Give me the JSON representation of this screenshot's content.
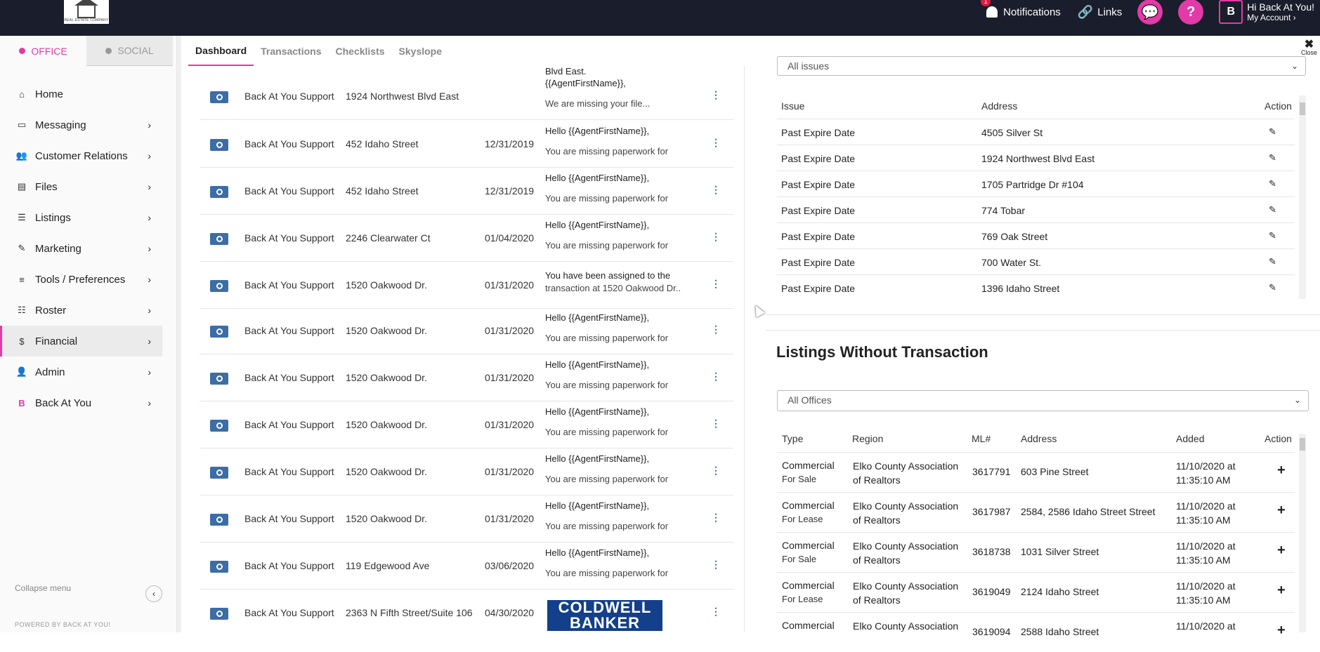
{
  "topbar": {
    "logo_text": "REAL ESTATE COMPANY",
    "notifications_label": "Notifications",
    "notifications_count": "1",
    "links_label": "Links",
    "chat_icon": "chat-bubble-icon",
    "help_icon": "?",
    "avatar_letter": "B",
    "greeting": "Hi Back At You!",
    "my_account": "My Account"
  },
  "sidebar": {
    "mode_tabs": [
      "OFFICE",
      "SOCIAL"
    ],
    "items": [
      {
        "label": "Home",
        "icon": "⌂"
      },
      {
        "label": "Messaging",
        "icon": "▭"
      },
      {
        "label": "Customer Relations",
        "icon": "👥"
      },
      {
        "label": "Files",
        "icon": "▤"
      },
      {
        "label": "Listings",
        "icon": "☰"
      },
      {
        "label": "Marketing",
        "icon": "✎"
      },
      {
        "label": "Tools / Preferences",
        "icon": "≡"
      },
      {
        "label": "Roster",
        "icon": "☷"
      },
      {
        "label": "Financial",
        "icon": "$"
      },
      {
        "label": "Admin",
        "icon": "👤"
      },
      {
        "label": "Back At You",
        "icon": "B"
      }
    ],
    "collapse_label": "Collapse menu",
    "powered_by": "POWERED BY BACK AT YOU!"
  },
  "main_tabs": [
    "Dashboard",
    "Transactions",
    "Checklists",
    "Skyslope"
  ],
  "close_label": "Close",
  "messages": {
    "partial_top": "Blvd East.",
    "rows": [
      {
        "sender": "Back At You Support",
        "address": "1924 Northwest Blvd East",
        "date": "",
        "msg1": "{{AgentFirstName}},",
        "msg2": "We are missing your file..."
      },
      {
        "sender": "Back At You Support",
        "address": "452 Idaho Street",
        "date": "12/31/2019",
        "msg1": "Hello {{AgentFirstName}},",
        "msg2": "You are missing paperwork for"
      },
      {
        "sender": "Back At You Support",
        "address": "452 Idaho Street",
        "date": "12/31/2019",
        "msg1": "Hello {{AgentFirstName}},",
        "msg2": "You are missing paperwork for"
      },
      {
        "sender": "Back At You Support",
        "address": "2246 Clearwater Ct",
        "date": "01/04/2020",
        "msg1": "Hello {{AgentFirstName}},",
        "msg2": "You are missing paperwork for"
      },
      {
        "sender": "Back At You Support",
        "address": "1520 Oakwood Dr.",
        "date": "01/31/2020",
        "msg1": "You have been assigned to the",
        "msg2": "transaction at 1520 Oakwood Dr.."
      },
      {
        "sender": "Back At You Support",
        "address": "1520 Oakwood Dr.",
        "date": "01/31/2020",
        "msg1": "Hello {{AgentFirstName}},",
        "msg2": "You are missing paperwork for"
      },
      {
        "sender": "Back At You Support",
        "address": "1520 Oakwood Dr.",
        "date": "01/31/2020",
        "msg1": "Hello {{AgentFirstName}},",
        "msg2": "You are missing paperwork for"
      },
      {
        "sender": "Back At You Support",
        "address": "1520 Oakwood Dr.",
        "date": "01/31/2020",
        "msg1": "Hello {{AgentFirstName}},",
        "msg2": "You are missing paperwork for"
      },
      {
        "sender": "Back At You Support",
        "address": "1520 Oakwood Dr.",
        "date": "01/31/2020",
        "msg1": "Hello {{AgentFirstName}},",
        "msg2": "You are missing paperwork for"
      },
      {
        "sender": "Back At You Support",
        "address": "1520 Oakwood Dr.",
        "date": "01/31/2020",
        "msg1": "Hello {{AgentFirstName}},",
        "msg2": "You are missing paperwork for"
      },
      {
        "sender": "Back At You Support",
        "address": "119 Edgewood Ave",
        "date": "03/06/2020",
        "msg1": "Hello {{AgentFirstName}},",
        "msg2": "You are missing paperwork for"
      },
      {
        "sender": "Back At You Support",
        "address": "2363 N Fifth Street/Suite 106",
        "date": "04/30/2020",
        "msg1": "",
        "msg2": ""
      }
    ],
    "coldwell_text": "COLDWELL BANKER"
  },
  "issues": {
    "filter_value": "All issues",
    "headers": [
      "Issue",
      "Address",
      "Action"
    ],
    "rows": [
      {
        "issue": "Past Expire Date",
        "address": "4505 Silver St"
      },
      {
        "issue": "Past Expire Date",
        "address": "1924 Northwest Blvd East"
      },
      {
        "issue": "Past Expire Date",
        "address": "1705 Partridge Dr #104"
      },
      {
        "issue": "Past Expire Date",
        "address": "774 Tobar"
      },
      {
        "issue": "Past Expire Date",
        "address": "769 Oak Street"
      },
      {
        "issue": "Past Expire Date",
        "address": "700 Water St."
      },
      {
        "issue": "Past Expire Date",
        "address": "1396 Idaho Street"
      }
    ],
    "edit_icon": "✎"
  },
  "listings": {
    "title": "Listings Without Transaction",
    "filter_value": "All Offices",
    "headers": [
      "Type",
      "Region",
      "ML#",
      "Address",
      "Added",
      "Action"
    ],
    "rows": [
      {
        "type": "Commercial",
        "sub": "For Sale",
        "region1": "Elko County Association",
        "region2": "of Realtors",
        "ml": "3617791",
        "address": "603 Pine Street",
        "added1": "11/10/2020 at",
        "added2": "11:35:10 AM"
      },
      {
        "type": "Commercial",
        "sub": "For Lease",
        "region1": "Elko County Association",
        "region2": "of Realtors",
        "ml": "3617987",
        "address": "2584, 2586 Idaho Street Street",
        "added1": "11/10/2020 at",
        "added2": "11:35:10 AM"
      },
      {
        "type": "Commercial",
        "sub": "For Sale",
        "region1": "Elko County Association",
        "region2": "of Realtors",
        "ml": "3618738",
        "address": "1031 Silver Street",
        "added1": "11/10/2020 at",
        "added2": "11:35:10 AM"
      },
      {
        "type": "Commercial",
        "sub": "For Lease",
        "region1": "Elko County Association",
        "region2": "of Realtors",
        "ml": "3619049",
        "address": "2124 Idaho Street",
        "added1": "11/10/2020 at",
        "added2": "11:35:10 AM"
      },
      {
        "type": "Commercial",
        "sub": "",
        "region1": "Elko County Association",
        "region2": "",
        "ml": "3619094",
        "address": "2588 Idaho Street",
        "added1": "11/10/2020 at",
        "added2": ""
      }
    ],
    "add_icon": "+"
  },
  "colors": {
    "accent": "#e23aa6",
    "topbar": "#1a1d2b",
    "eye_button": "#3c6ea5"
  }
}
